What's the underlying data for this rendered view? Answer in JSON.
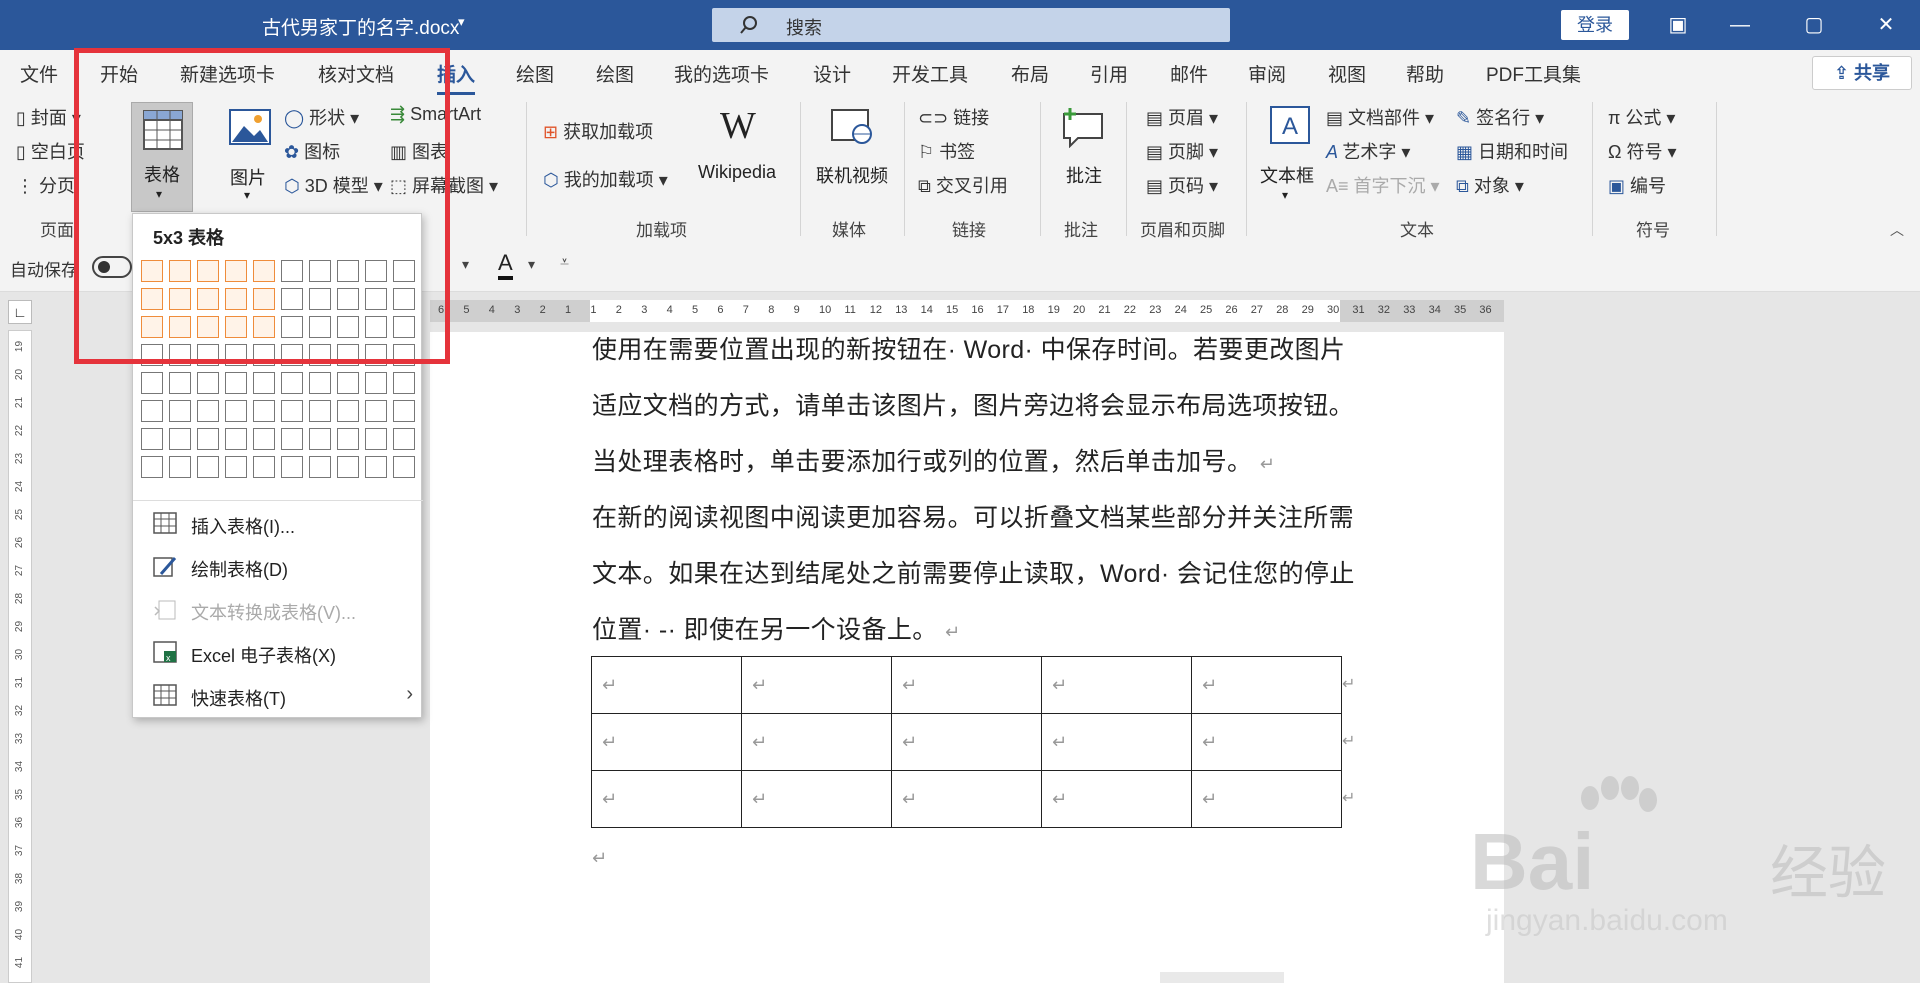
{
  "titlebar": {
    "doc_title": "古代男家丁的名字.docx",
    "caret": "▾",
    "search_placeholder": "搜索",
    "login": "登录",
    "minimize": "—",
    "restore": "▢",
    "close": "✕",
    "ribbon_display": "▣"
  },
  "tabs": [
    "文件",
    "开始",
    "新建选项卡",
    "核对文档",
    "插入",
    "绘图",
    "绘图",
    "我的选项卡",
    "设计",
    "开发工具",
    "布局",
    "引用",
    "邮件",
    "审阅",
    "视图",
    "帮助",
    "PDF工具集"
  ],
  "active_tab": "插入",
  "share": "共享",
  "ribbon": {
    "pages_group": {
      "items": [
        "封面",
        "空白页",
        "分页"
      ],
      "label": "页面"
    },
    "table_button": "表格",
    "illustrations": {
      "picture": "图片",
      "shapes": "形状",
      "icons": "图标",
      "model3d": "3D 模型",
      "smartart": "SmartArt",
      "chart": "图表",
      "screenshot": "屏幕截图"
    },
    "addins": {
      "get": "获取加载项",
      "mine": "我的加载项",
      "wikipedia": "Wikipedia",
      "label": "加载项"
    },
    "media": {
      "video": "联机视频",
      "label": "媒体"
    },
    "links": {
      "link": "链接",
      "bookmark": "书签",
      "crossref": "交叉引用",
      "label": "链接"
    },
    "comments": {
      "comment": "批注",
      "label": "批注"
    },
    "headerfooter": {
      "header": "页眉",
      "footer": "页脚",
      "pagenum": "页码",
      "label": "页眉和页脚"
    },
    "text": {
      "textbox": "文本框",
      "docparts": "文档部件",
      "wordart": "艺术字",
      "dropcap": "首字下沉",
      "sigline": "签名行",
      "datetime": "日期和时间",
      "object": "对象",
      "label": "文本"
    },
    "symbols": {
      "equation": "公式",
      "symbol": "符号",
      "number": "编号",
      "label": "符号"
    }
  },
  "qat": {
    "autosave": "自动保存",
    "font_color_letter": "A"
  },
  "dropdown": {
    "title": "5x3 表格",
    "grid_cols": 10,
    "grid_rows": 8,
    "selected_cols": 5,
    "selected_rows": 3,
    "items": [
      {
        "label": "插入表格(I)...",
        "icon": "table-icon"
      },
      {
        "label": "绘制表格(D)",
        "icon": "draw-table-icon"
      },
      {
        "label": "文本转换成表格(V)...",
        "icon": "convert-text-icon",
        "disabled": true
      },
      {
        "label": "Excel 电子表格(X)",
        "icon": "excel-icon"
      },
      {
        "label": "快速表格(T)",
        "icon": "quick-table-icon",
        "submenu": true
      }
    ]
  },
  "document": {
    "paragraphs": [
      "使用在需要位置出现的新按钮在· Word· 中保存时间。若要更改图片",
      "适应文档的方式，请单击该图片，图片旁边将会显示布局选项按钮。",
      "当处理表格时，单击要添加行或列的位置，然后单击加号。",
      "在新的阅读视图中阅读更加容易。可以折叠文档某些部分并关注所需",
      "文本。如果在达到结尾处之前需要停止读取，Word· 会记住您的停止",
      "位置· -· 即使在另一个设备上。"
    ],
    "para_mark": "↵",
    "table_rows": 3,
    "table_cols": 5
  },
  "ruler": {
    "h_numbers": [
      "6",
      "5",
      "4",
      "3",
      "2",
      "1",
      "1",
      "2",
      "3",
      "4",
      "5",
      "6",
      "7",
      "8",
      "9",
      "10",
      "11",
      "12",
      "13",
      "14",
      "15",
      "16",
      "17",
      "18",
      "19",
      "20",
      "21",
      "22",
      "23",
      "24",
      "25",
      "26",
      "27",
      "28",
      "29",
      "30",
      "31",
      "32",
      "33",
      "34",
      "35",
      "36"
    ],
    "v_numbers": [
      "19",
      "20",
      "21",
      "22",
      "23",
      "24",
      "25",
      "26",
      "27",
      "28",
      "29",
      "30",
      "31",
      "32",
      "33",
      "34",
      "35",
      "36",
      "37",
      "38",
      "39",
      "40",
      "41"
    ]
  },
  "watermark": {
    "brand": "Bai",
    "brand_cn": "经验",
    "url": "jingyan.baidu.com"
  },
  "colors": {
    "accent": "#2b579a",
    "highlight": "#e5333b",
    "grid_selected": "#ef8c3b"
  }
}
